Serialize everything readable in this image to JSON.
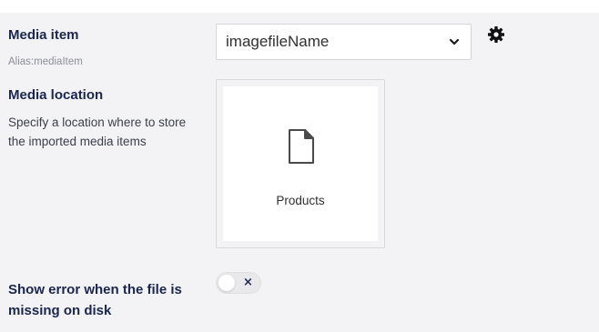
{
  "media_item": {
    "label": "Media item",
    "alias": "Alias:mediaItem",
    "selected_value": "imagefileName",
    "settings_icon": "gear-icon",
    "chevron_icon": "chevron-down-icon"
  },
  "media_location": {
    "label": "Media location",
    "description": "Specify a location where to store the imported media items",
    "selected_item_name": "Products",
    "item_icon": "file-icon"
  },
  "show_error": {
    "label": "Show error when the file is missing on disk",
    "toggle_state": "off",
    "toggle_symbol": "×"
  },
  "colors": {
    "panel_bg": "#f3f3f5",
    "label_text": "#1b264f",
    "muted_text": "#8c8f9a"
  }
}
